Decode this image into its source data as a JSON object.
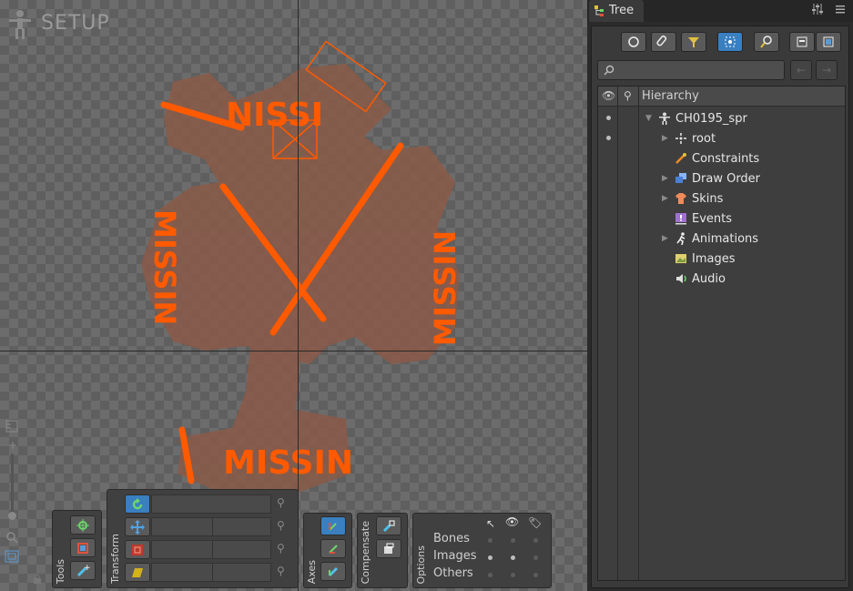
{
  "viewport": {
    "mode": "SETUP",
    "art_text": {
      "top": "NISSI",
      "left": "MISSIN",
      "right": "MISSIN",
      "bottom": "MISSIN"
    }
  },
  "toolbars": {
    "tools_label": "Tools",
    "transform_label": "Transform",
    "axes_label": "Axes",
    "compensate_label": "Compensate",
    "options_label": "Options",
    "options_rows": [
      "Bones",
      "Images",
      "Others"
    ]
  },
  "panel": {
    "tab_label": "Tree",
    "search_placeholder": "",
    "hierarchy_label": "Hierarchy",
    "tree": {
      "skeleton": "CH0195_spr",
      "items": [
        "root",
        "Constraints",
        "Draw Order",
        "Skins",
        "Events",
        "Animations",
        "Images",
        "Audio"
      ]
    }
  },
  "colors": {
    "accent": "#3a7fc0",
    "art": "#ff5a00",
    "art_fill": "#8a5a48"
  },
  "icons": [
    "setup-figure-icon",
    "tree-tab-icon",
    "settings-sliders-icon",
    "menu-icon",
    "bone-icon",
    "constraints-icon",
    "draw-order-icon",
    "skins-icon",
    "events-icon",
    "animations-icon",
    "images-icon",
    "audio-icon"
  ]
}
